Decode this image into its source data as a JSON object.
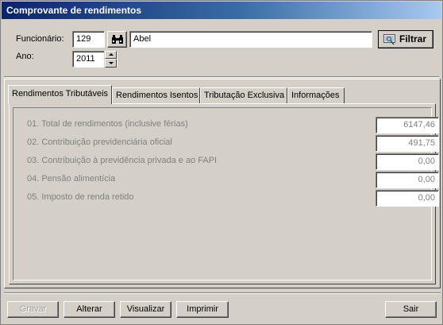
{
  "window": {
    "title": "Comprovante de rendimentos"
  },
  "filters": {
    "funcionario_label": "Funcionário:",
    "funcionario_code": "129",
    "funcionario_name": "Abel",
    "search_icon": "binoculars-icon",
    "filter_button_label": "Filtrar",
    "filter_icon": "filter-screen-icon",
    "ano_label": "Ano:",
    "ano_value": "2011"
  },
  "tabs": [
    {
      "label": "Rendimentos Tributáveis",
      "active": true
    },
    {
      "label": "Rendimentos Isentos",
      "active": false
    },
    {
      "label": "Tributação Exclusiva",
      "active": false
    },
    {
      "label": "Informações",
      "active": false
    }
  ],
  "rows": [
    {
      "label": "01. Total de rendimentos (inclusive férias)",
      "value": "6147,46"
    },
    {
      "label": "02. Contribuição previdenciária oficial",
      "value": "491,75"
    },
    {
      "label": "03. Contribuição à previdência privada e  ao FAPI",
      "value": "0,00"
    },
    {
      "label": "04. Pensão alimentícia",
      "value": "0,00"
    },
    {
      "label": "05. Imposto de renda retido",
      "value": "0,00"
    }
  ],
  "footer": {
    "gravar": "Gravar",
    "alterar": "Alterar",
    "visualizar": "Visualizar",
    "imprimir": "Imprimir",
    "sair": "Sair"
  },
  "colors": {
    "title_bar_start": "#0a246a",
    "title_bar_end": "#a6caf0",
    "face": "#d4d0c8",
    "disabled_text": "#808080"
  }
}
